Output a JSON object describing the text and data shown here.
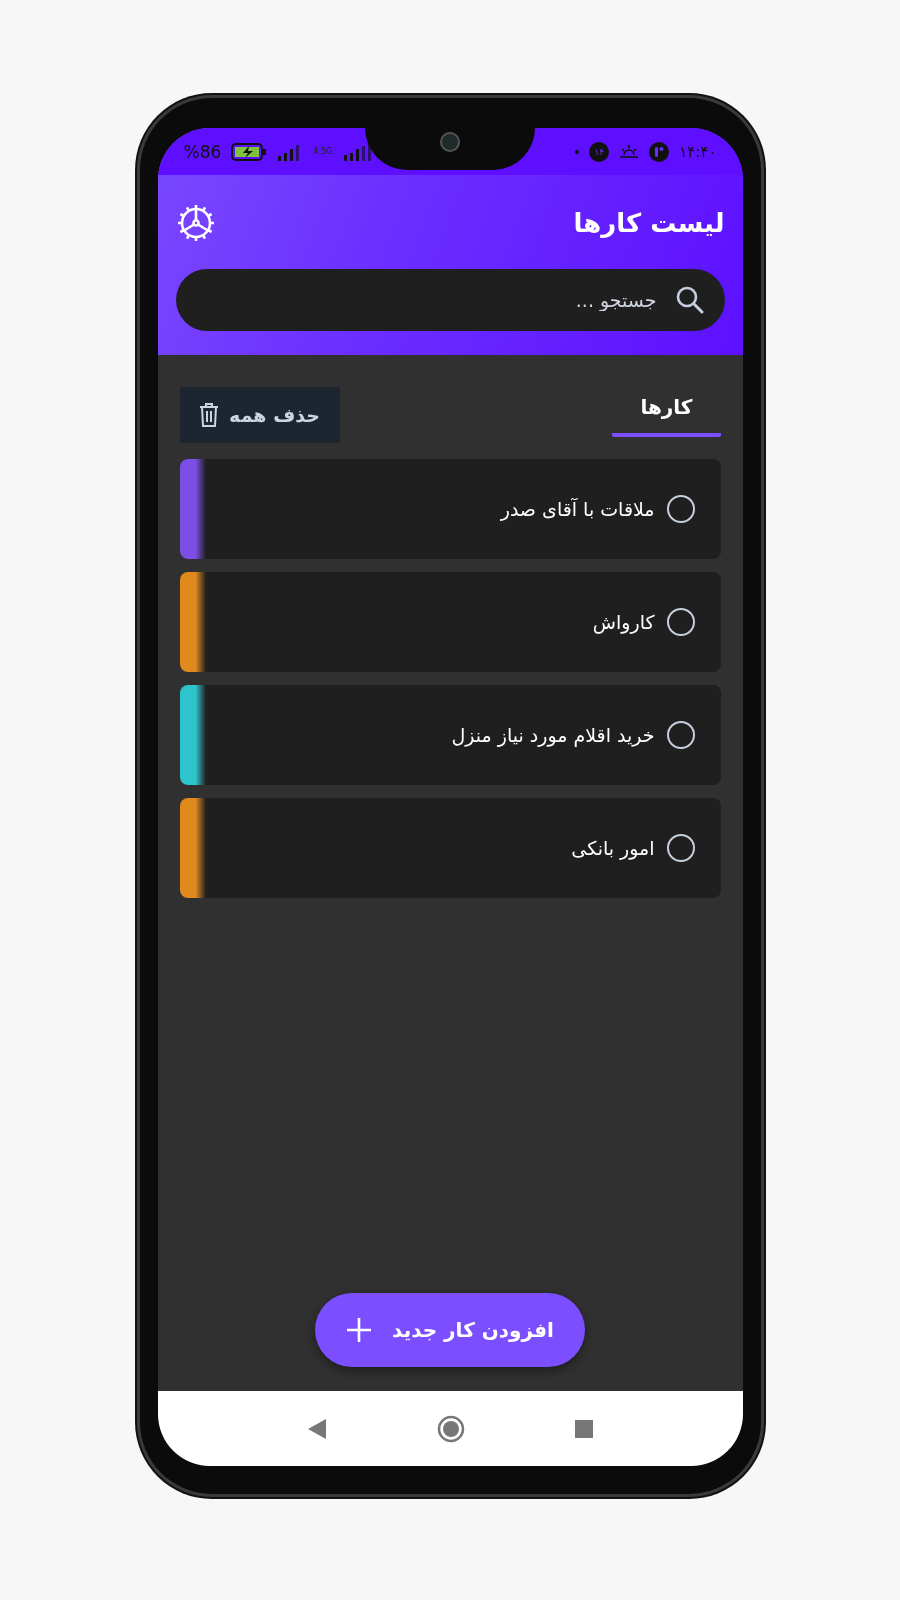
{
  "status_bar": {
    "time": "۱۴:۴۰",
    "badge": "۱۴",
    "battery": "%86",
    "network": "4.5G"
  },
  "header": {
    "title": "لیست کارها"
  },
  "search": {
    "placeholder": "جستجو ..."
  },
  "tabs": [
    {
      "label": "کارها",
      "selected": true
    }
  ],
  "delete_all": {
    "label": "حذف همه"
  },
  "tasks": [
    {
      "title": "ملاقات با آقای صدر",
      "color": "#7b4fe6",
      "done": false
    },
    {
      "title": "کارواش",
      "color": "#e08a1e",
      "done": false
    },
    {
      "title": "خرید اقلام مورد نیاز منزل",
      "color": "#2ec4cc",
      "done": false
    },
    {
      "title": "امور بانکی",
      "color": "#e08a1e",
      "done": false
    }
  ],
  "add_button": {
    "label": "افزودن کار جدید"
  }
}
